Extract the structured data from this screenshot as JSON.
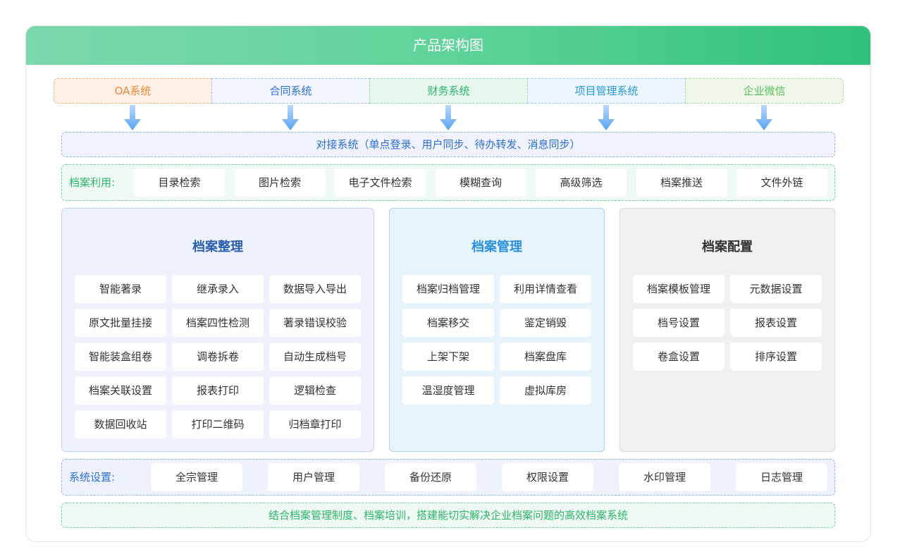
{
  "title": "产品架构图",
  "systems": [
    {
      "label": "OA系统",
      "color": "#f0883a",
      "bg": "#fdf0e6",
      "border": "#f5b27a"
    },
    {
      "label": "合同系统",
      "color": "#2b6fd6",
      "bg": "#f3f6fd",
      "border": "#9dbbe9"
    },
    {
      "label": "财务系统",
      "color": "#2cb56a",
      "bg": "#e6f7ee",
      "border": "#8fd9b0"
    },
    {
      "label": "项目管理系统",
      "color": "#2b9bd6",
      "bg": "#eaf5fc",
      "border": "#9ccfee"
    },
    {
      "label": "企业微信",
      "color": "#5bbf5b",
      "bg": "#eef7ea",
      "border": "#a9dca4"
    }
  ],
  "dock_text": "对接系统（单点登录、用户同步、待办转发、消息同步）",
  "usage": {
    "label": "档案利用:",
    "items": [
      "目录检索",
      "图片检索",
      "电子文件检索",
      "模糊查询",
      "高级筛选",
      "档案推送",
      "文件外链"
    ]
  },
  "panels": {
    "organize": {
      "title": "档案整理",
      "items": [
        "智能著录",
        "继承录入",
        "数据导入导出",
        "原文批量挂接",
        "档案四性检测",
        "著录错误校验",
        "智能装盒组卷",
        "调卷拆卷",
        "自动生成档号",
        "档案关联设置",
        "报表打印",
        "逻辑检查",
        "数据回收站",
        "打印二维码",
        "归档章打印"
      ]
    },
    "manage": {
      "title": "档案管理",
      "items": [
        "档案归档管理",
        "利用详情查看",
        "档案移交",
        "鉴定销毁",
        "上架下架",
        "档案盘库",
        "温湿度管理",
        "虚拟库房"
      ]
    },
    "config": {
      "title": "档案配置",
      "items": [
        "档案模板管理",
        "元数据设置",
        "档号设置",
        "报表设置",
        "卷盒设置",
        "排序设置"
      ]
    }
  },
  "settings": {
    "label": "系统设置:",
    "items": [
      "全宗管理",
      "用户管理",
      "备份还原",
      "权限设置",
      "水印管理",
      "日志管理"
    ]
  },
  "footer_text": "结合档案管理制度、档案培训，搭建能切实解决企业档案问题的高效档案系统",
  "colors": {
    "header_start": "#7dd8ad",
    "header_end": "#2fc27a",
    "blue": "#2b6fd6",
    "green": "#2cb56a",
    "arrow": "#5aa2f0"
  }
}
